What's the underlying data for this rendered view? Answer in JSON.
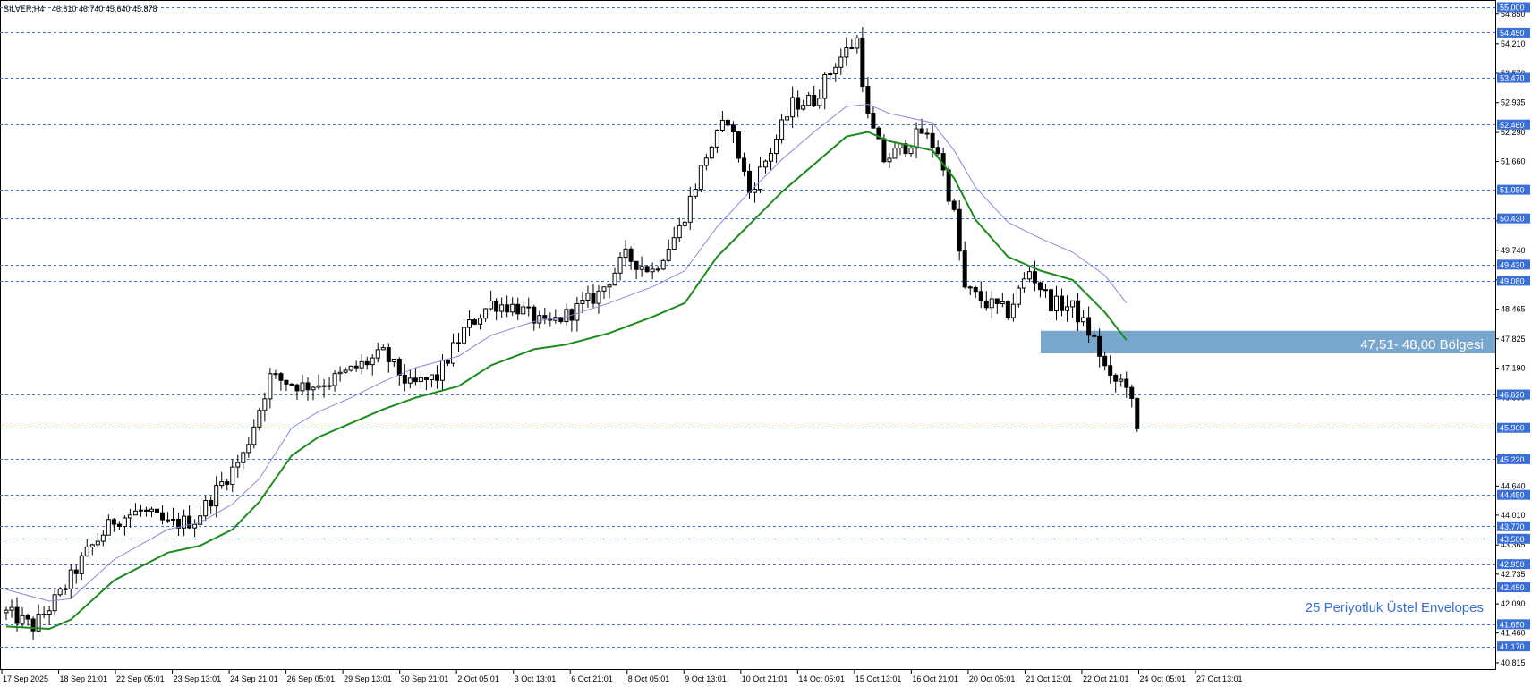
{
  "header": {
    "symbol": "SILVER,H4",
    "ohlc": "46.610 46.740 45.640 45.878"
  },
  "colors": {
    "grid_line": "#3a6fd8",
    "tag_bg": "#3a6fd8",
    "ema_line": "#1a8c1a",
    "envelope_line": "#8888dd",
    "zone_fill": "#6a9cc8",
    "annotation_text": "#3a6fd8"
  },
  "annotations": {
    "zone_label": "47,51- 48,00 Bölgesi",
    "envelope_label": "25 Periyotluk Üstel Envelopes"
  },
  "chart_data": {
    "type": "candlestick",
    "symbol": "SILVER",
    "timeframe": "H4",
    "ylim": [
      40.6,
      55.1
    ],
    "ticks_left": [
      "55.000",
      "54.850",
      "54.210",
      "53.570",
      "52.935",
      "52.290",
      "51.660",
      "51.020",
      "50.380",
      "49.740",
      "49.100",
      "48.465",
      "47.825",
      "47.190",
      "46.550",
      "45.900",
      "45.270",
      "44.640",
      "44.010",
      "43.365",
      "42.735",
      "42.090",
      "41.460",
      "40.815"
    ],
    "horizontal_levels": [
      "55.000",
      "54.450",
      "53.470",
      "52.460",
      "51.050",
      "50.430",
      "49.430",
      "49.080",
      "46.620",
      "45.900",
      "45.220",
      "44.450",
      "43.770",
      "43.500",
      "42.950",
      "42.450",
      "41.650",
      "41.170"
    ],
    "current_price_level": "45.900",
    "x_labels": [
      "17 Sep 2025",
      "18 Sep 21:01",
      "22 Sep 05:01",
      "23 Sep 13:01",
      "24 Sep 21:01",
      "26 Sep 05:01",
      "29 Sep 13:01",
      "30 Sep 21:01",
      "2 Oct 05:01",
      "3 Oct 13:01",
      "6 Oct 21:01",
      "8 Oct 05:01",
      "9 Oct 13:01",
      "10 Oct 21:01",
      "14 Oct 05:01",
      "15 Oct 13:01",
      "16 Oct 21:01",
      "20 Oct 05:01",
      "21 Oct 13:01",
      "22 Oct 21:01",
      "24 Oct 05:01",
      "27 Oct 13:01"
    ],
    "zone": {
      "low": 47.51,
      "high": 48.0,
      "label": "47,51- 48,00 Bölgesi"
    },
    "trend_path": [
      {
        "i": 0,
        "p": 41.9
      },
      {
        "i": 5,
        "p": 41.6
      },
      {
        "i": 10,
        "p": 42.3
      },
      {
        "i": 15,
        "p": 43.2
      },
      {
        "i": 20,
        "p": 43.9
      },
      {
        "i": 25,
        "p": 44.1
      },
      {
        "i": 30,
        "p": 43.8
      },
      {
        "i": 35,
        "p": 43.9
      },
      {
        "i": 40,
        "p": 44.7
      },
      {
        "i": 44,
        "p": 45.3
      },
      {
        "i": 49,
        "p": 47.0
      },
      {
        "i": 55,
        "p": 46.8
      },
      {
        "i": 60,
        "p": 46.9
      },
      {
        "i": 65,
        "p": 47.2
      },
      {
        "i": 70,
        "p": 47.5
      },
      {
        "i": 75,
        "p": 46.8
      },
      {
        "i": 80,
        "p": 47.0
      },
      {
        "i": 85,
        "p": 48.0
      },
      {
        "i": 90,
        "p": 48.6
      },
      {
        "i": 95,
        "p": 48.5
      },
      {
        "i": 100,
        "p": 48.1
      },
      {
        "i": 105,
        "p": 48.4
      },
      {
        "i": 110,
        "p": 48.8
      },
      {
        "i": 115,
        "p": 49.6
      },
      {
        "i": 120,
        "p": 49.3
      },
      {
        "i": 125,
        "p": 50.2
      },
      {
        "i": 130,
        "p": 51.8
      },
      {
        "i": 134,
        "p": 52.6
      },
      {
        "i": 138,
        "p": 51.0
      },
      {
        "i": 142,
        "p": 51.9
      },
      {
        "i": 146,
        "p": 52.9
      },
      {
        "i": 150,
        "p": 53.0
      },
      {
        "i": 154,
        "p": 53.8
      },
      {
        "i": 158,
        "p": 54.3
      },
      {
        "i": 160,
        "p": 52.6
      },
      {
        "i": 163,
        "p": 51.7
      },
      {
        "i": 167,
        "p": 52.0
      },
      {
        "i": 170,
        "p": 52.3
      },
      {
        "i": 173,
        "p": 51.9
      },
      {
        "i": 176,
        "p": 50.5
      },
      {
        "i": 178,
        "p": 48.9
      },
      {
        "i": 182,
        "p": 48.6
      },
      {
        "i": 186,
        "p": 48.4
      },
      {
        "i": 190,
        "p": 49.3
      },
      {
        "i": 194,
        "p": 48.6
      },
      {
        "i": 198,
        "p": 48.5
      },
      {
        "i": 202,
        "p": 47.8
      },
      {
        "i": 205,
        "p": 46.9
      },
      {
        "i": 208,
        "p": 46.9
      },
      {
        "i": 210,
        "p": 45.878
      }
    ],
    "series": [
      {
        "name": "EMA 25",
        "role": "ema",
        "points": [
          [
            0,
            41.6
          ],
          [
            8,
            41.55
          ],
          [
            12,
            41.75
          ],
          [
            20,
            42.6
          ],
          [
            30,
            43.2
          ],
          [
            36,
            43.35
          ],
          [
            42,
            43.7
          ],
          [
            47,
            44.3
          ],
          [
            53,
            45.3
          ],
          [
            58,
            45.7
          ],
          [
            64,
            46.0
          ],
          [
            70,
            46.3
          ],
          [
            76,
            46.55
          ],
          [
            84,
            46.8
          ],
          [
            90,
            47.25
          ],
          [
            98,
            47.6
          ],
          [
            104,
            47.7
          ],
          [
            112,
            47.95
          ],
          [
            120,
            48.3
          ],
          [
            126,
            48.6
          ],
          [
            132,
            49.6
          ],
          [
            138,
            50.3
          ],
          [
            144,
            51.0
          ],
          [
            150,
            51.6
          ],
          [
            156,
            52.2
          ],
          [
            160,
            52.3
          ],
          [
            164,
            52.1
          ],
          [
            168,
            52.0
          ],
          [
            172,
            51.9
          ],
          [
            176,
            51.3
          ],
          [
            180,
            50.4
          ],
          [
            186,
            49.6
          ],
          [
            192,
            49.3
          ],
          [
            198,
            49.1
          ],
          [
            204,
            48.4
          ],
          [
            208,
            47.8
          ]
        ]
      },
      {
        "name": "Envelope",
        "role": "envelope",
        "points": [
          [
            0,
            42.4
          ],
          [
            8,
            42.15
          ],
          [
            12,
            42.2
          ],
          [
            20,
            43.05
          ],
          [
            30,
            43.7
          ],
          [
            36,
            43.85
          ],
          [
            42,
            44.25
          ],
          [
            47,
            44.8
          ],
          [
            53,
            45.9
          ],
          [
            58,
            46.25
          ],
          [
            64,
            46.55
          ],
          [
            70,
            46.9
          ],
          [
            76,
            47.2
          ],
          [
            84,
            47.45
          ],
          [
            90,
            47.9
          ],
          [
            98,
            48.2
          ],
          [
            104,
            48.3
          ],
          [
            112,
            48.6
          ],
          [
            120,
            48.95
          ],
          [
            126,
            49.3
          ],
          [
            132,
            50.25
          ],
          [
            138,
            51.0
          ],
          [
            144,
            51.7
          ],
          [
            150,
            52.3
          ],
          [
            156,
            52.85
          ],
          [
            160,
            52.9
          ],
          [
            164,
            52.7
          ],
          [
            168,
            52.6
          ],
          [
            172,
            52.5
          ],
          [
            176,
            51.9
          ],
          [
            180,
            51.1
          ],
          [
            186,
            50.35
          ],
          [
            192,
            50.0
          ],
          [
            198,
            49.7
          ],
          [
            204,
            49.2
          ],
          [
            208,
            48.6
          ]
        ]
      }
    ]
  }
}
